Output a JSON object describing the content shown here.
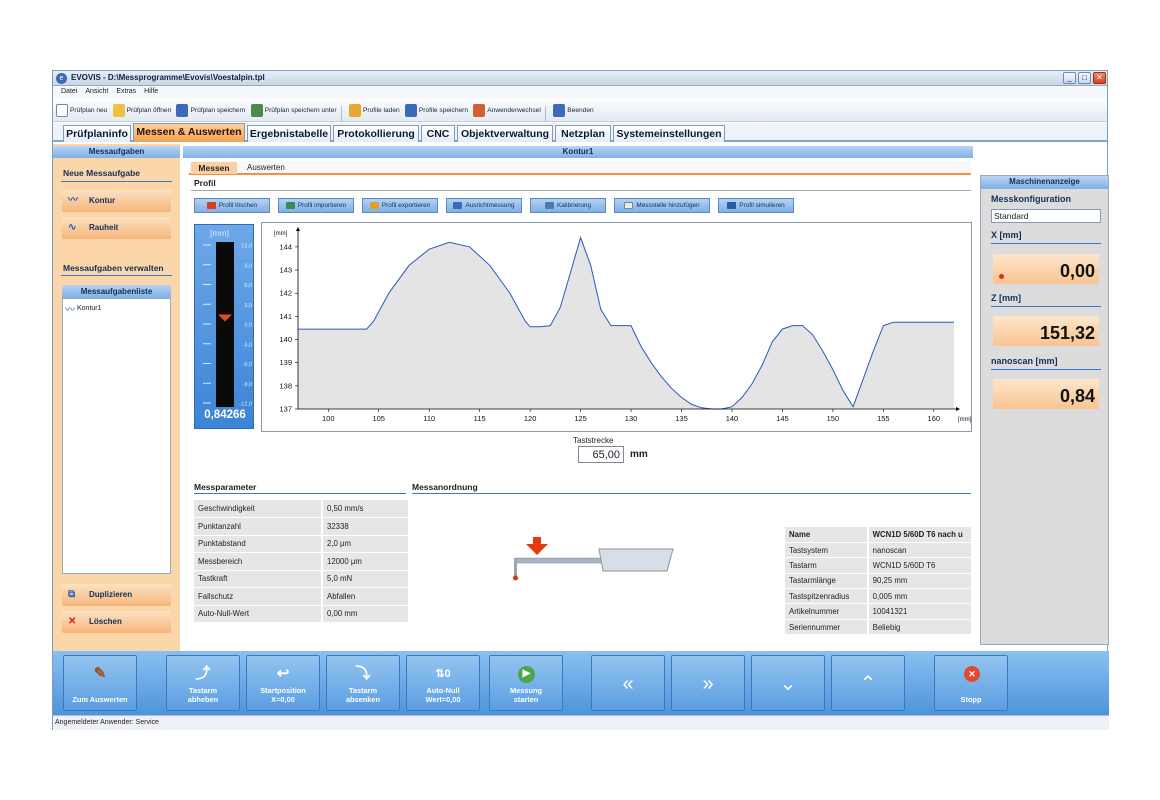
{
  "window": {
    "title": "EVOVIS - D:\\Messprogramme\\Evovis\\Voestalpin.tpl",
    "buttons": [
      "_",
      "□",
      "✕"
    ]
  },
  "menu": [
    "Datei",
    "Ansicht",
    "Extras",
    "Hilfe"
  ],
  "toolbar": [
    "Prüfplan neu",
    "Prüfplan öffnen",
    "Prüfplan speichern",
    "Prüfplan speichern unter",
    "Profile laden",
    "Profile speichern",
    "Anwenderwechsel",
    "Beenden"
  ],
  "tabs": [
    "Prüfplaninfo",
    "Messen & Auswerten",
    "Ergebnistabelle",
    "Protokollierung",
    "CNC",
    "Objektverwaltung",
    "Netzplan",
    "Systemeinstellungen"
  ],
  "left": {
    "header": "Messaufgaben",
    "new_section": "Neue Messaufgabe",
    "btn_kontur": "Kontur",
    "btn_rauheit": "Rauheit",
    "manage_section": "Messaufgaben verwalten",
    "list_header": "Messaufgabenliste",
    "list_items": [
      "Kontur1"
    ],
    "btn_duplicate": "Duplizieren",
    "btn_delete": "Löschen"
  },
  "center": {
    "header": "Kontur1",
    "subtabs": [
      "Messen",
      "Auswerten"
    ],
    "profile_label": "Profil",
    "profile_buttons": [
      "Profil löschen",
      "Profil importieren",
      "Profil exportieren",
      "Ausrichtmessung",
      "Kalibrierung",
      "Messstelle hinzufügen",
      "Profil simulieren"
    ],
    "gauge": {
      "unit": "[mm]",
      "ticks": [
        "12,0",
        "9,0",
        "6,0",
        "3,0",
        "0,0",
        "-3,0",
        "-6,0",
        "-9,0",
        "-12,0"
      ],
      "value_text": "0,84266",
      "value": 0.84266
    },
    "teststrecke_label": "Taststrecke",
    "teststrecke_value": "65,00",
    "teststrecke_unit": "mm",
    "params_title": "Messparameter",
    "params": [
      [
        "Geschwindigkeit",
        "0,50 mm/s"
      ],
      [
        "Punktanzahl",
        "32338"
      ],
      [
        "Punktabstand",
        "2,0 µm"
      ],
      [
        "Messbereich",
        "12000 µm"
      ],
      [
        "Tastkraft",
        "5,0 mN"
      ],
      [
        "Fallschutz",
        "Abfallen"
      ],
      [
        "Auto-Null-Wert",
        "0,00 mm"
      ]
    ],
    "arrangement_title": "Messanordnung",
    "info": [
      [
        "Name",
        "WCN1D 5/60D T6 nach u"
      ],
      [
        "Tastsystem",
        "nanoscan"
      ],
      [
        "Tastarm",
        "WCN1D 5/60D T6"
      ],
      [
        "Tastarmlänge",
        "90,25 mm"
      ],
      [
        "Tastspitzenradius",
        "0,005 mm"
      ],
      [
        "Artikelnummer",
        "10041321"
      ],
      [
        "Seriennummer",
        "Beliebig"
      ]
    ]
  },
  "right": {
    "header": "Maschinenanzeige",
    "config_label": "Messkonfiguration",
    "config_value": "Standard",
    "x_label": "X [mm]",
    "x_value": "0,00",
    "z_label": "Z [mm]",
    "z_value": "151,32",
    "n_label": "nanoscan [mm]",
    "n_value": "0,84"
  },
  "bottom": {
    "buttons": [
      "Zum Auswerten",
      "Tastarm abheben",
      "Startposition X=0,00",
      "Tastarm absenken",
      "Auto-Null Wert=0,00",
      "Messung starten",
      "Stopp"
    ]
  },
  "status": "Angemeldeter Anwender:  Service",
  "chart_data": {
    "type": "area",
    "xlabel": "[mm]",
    "ylabel": "[mm]",
    "xlim": [
      97,
      162
    ],
    "ylim": [
      137,
      144.6
    ],
    "xticks": [
      100,
      105,
      110,
      115,
      120,
      125,
      130,
      135,
      140,
      145,
      150,
      155,
      160
    ],
    "yticks": [
      137,
      138,
      139,
      140,
      141,
      142,
      143,
      144
    ],
    "series": [
      {
        "x": [
          97,
          103.8,
          104.5,
          106,
          108,
          110,
          112,
          114,
          116,
          118,
          119.5,
          120,
          121,
          122,
          123,
          124,
          125,
          126,
          127,
          128,
          129,
          130,
          131,
          132,
          133,
          134,
          135,
          136,
          137,
          138,
          139,
          140,
          141,
          142,
          143,
          144,
          145,
          146,
          147,
          148,
          149,
          150,
          151,
          152,
          153,
          154,
          155,
          156,
          157,
          158,
          160,
          162
        ],
        "y": [
          140.45,
          140.45,
          140.8,
          142,
          143.2,
          143.9,
          144.2,
          144,
          143.2,
          142,
          140.8,
          140.55,
          140.55,
          140.6,
          141.4,
          142.9,
          144.4,
          143.2,
          141.3,
          140.6,
          140.6,
          140.6,
          139.7,
          139,
          138.4,
          137.9,
          137.5,
          137.2,
          137.05,
          137,
          137,
          137.1,
          137.5,
          138.1,
          138.9,
          139.9,
          140.45,
          140.6,
          140.6,
          140.2,
          139.5,
          138.7,
          137.8,
          137.1,
          138.3,
          139.5,
          140.6,
          140.75,
          140.75,
          140.75,
          140.75,
          140.75
        ]
      }
    ]
  }
}
